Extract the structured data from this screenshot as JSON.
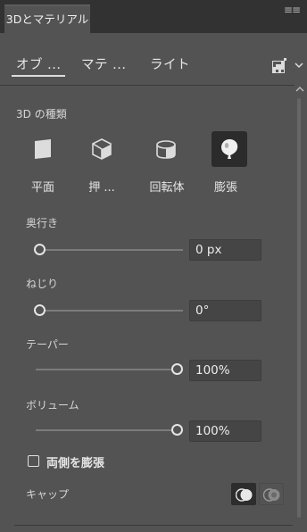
{
  "panel": {
    "tab_title": "3Dとマテリアル",
    "menu_glyph": "≡≡"
  },
  "subtabs": [
    {
      "label": "オブ ..."
    },
    {
      "label": "マテ ..."
    },
    {
      "label": "ライト"
    }
  ],
  "section": {
    "heading": "3D の種類"
  },
  "types": [
    {
      "label": "平面",
      "icon": "plane-icon"
    },
    {
      "label": "押 ...",
      "icon": "extrude-icon"
    },
    {
      "label": "回転体",
      "icon": "revolve-icon"
    },
    {
      "label": "膨張",
      "icon": "inflate-icon",
      "selected": true
    }
  ],
  "params": {
    "depth": {
      "label": "奥行き",
      "value": "0 px",
      "level": 0
    },
    "twist": {
      "label": "ねじり",
      "value": "0°",
      "level": 0
    },
    "taper": {
      "label": "テーパー",
      "value": "100%",
      "level": 1
    },
    "volume": {
      "label": "ボリューム",
      "value": "100%",
      "level": 1
    }
  },
  "inflate_both_sides": {
    "label": "両側を膨張",
    "checked": false
  },
  "cap": {
    "label": "キャップ",
    "options": [
      "cap-on-icon",
      "cap-off-icon"
    ],
    "selected": 0
  },
  "colors": {
    "background": "#535353",
    "tabbar": "#323232",
    "field": "#454545",
    "selected_button": "#2b2b2b"
  }
}
